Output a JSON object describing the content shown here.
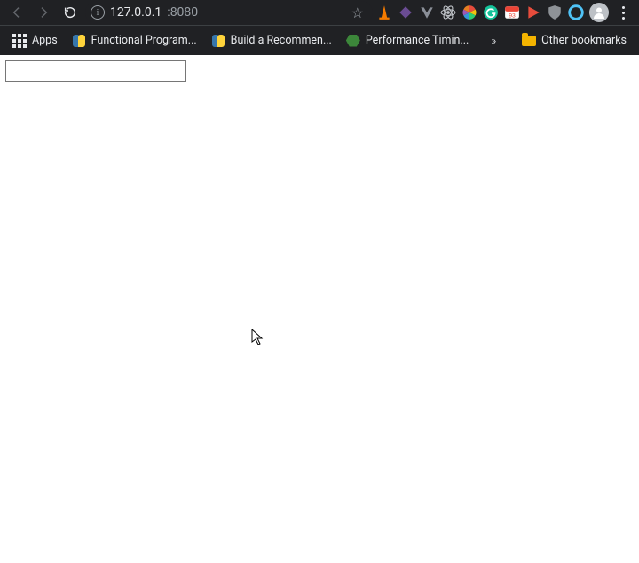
{
  "address_bar": {
    "host": "127.0.0.1",
    "port": ":8080"
  },
  "bookmarks_bar": {
    "apps_label": "Apps",
    "items": [
      {
        "label": "Functional Program..."
      },
      {
        "label": "Build a Recommen..."
      },
      {
        "label": "Performance Timin..."
      }
    ],
    "other_label": "Other bookmarks"
  },
  "page": {
    "input_value": ""
  }
}
